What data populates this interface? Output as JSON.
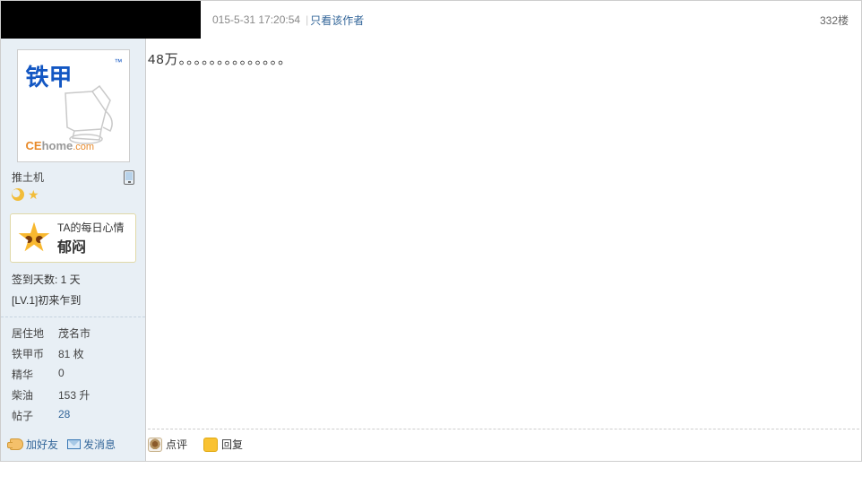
{
  "meta": {
    "timestamp": "015-5-31 17:20:54",
    "only_author": "只看该作者",
    "floor": "332楼"
  },
  "content": {
    "text": "48万。。。。。。。。。。。。。。"
  },
  "actions": {
    "rate": "点评",
    "reply": "回复"
  },
  "user": {
    "brand_cn": "铁甲",
    "brand_tm": "™",
    "brand_en_left": "CE",
    "brand_en_mid": "home",
    "brand_en_right": ".com",
    "title": "推土机",
    "mood_label": "TA的每日心情",
    "mood_value": "郁闷",
    "sign_days": "签到天数: 1 天",
    "level": "[LV.1]初来乍到",
    "stats": [
      {
        "k": "居住地",
        "v": "茂名市",
        "link": false
      },
      {
        "k": "铁甲币",
        "v": "81 枚",
        "link": false
      },
      {
        "k": "精华",
        "v": "0",
        "link": false
      },
      {
        "k": "柴油",
        "v": "153 升",
        "link": false
      },
      {
        "k": "帖子",
        "v": "28",
        "link": true
      }
    ],
    "add_friend": "加好友",
    "send_msg": "发消息"
  }
}
